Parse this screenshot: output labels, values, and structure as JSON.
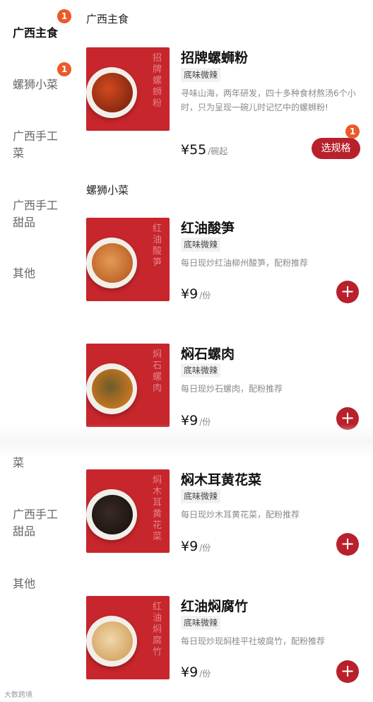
{
  "sidebar": {
    "categories": [
      {
        "label": "广西主食",
        "badge": "1",
        "active": true
      },
      {
        "label": "螺狮小菜",
        "badge": "1"
      },
      {
        "label": "广西手工菜"
      },
      {
        "label": "广西手工甜品"
      },
      {
        "label": "其他"
      },
      {
        "label": "菜"
      },
      {
        "label": "广西手工甜品"
      },
      {
        "label": "其他"
      }
    ]
  },
  "sections": [
    {
      "title": "广西主食"
    },
    {
      "title": "螺狮小菜"
    }
  ],
  "products": [
    {
      "name": "招牌螺蛳粉",
      "thumb_text": "招牌螺蛳粉",
      "tag": "底味微辣",
      "desc": "寻味山海，两年研发，四十多种食材熬汤6个小时，只为呈现一碗儿时记忆中的螺蛳粉!",
      "price": "¥55",
      "unit": "/碗起",
      "action_label": "选规格",
      "action_badge": "1"
    },
    {
      "name": "红油酸笋",
      "thumb_text": "红油酸笋",
      "tag": "底味微辣",
      "desc": "每日现炒红油柳州酸笋，配粉推荐",
      "price": "¥9",
      "unit": "/份",
      "action_label": "+"
    },
    {
      "name": "焖石螺肉",
      "thumb_text": "焖石螺肉",
      "tag": "底味微辣",
      "desc": "每日现炒石螺肉，配粉推荐",
      "price": "¥9",
      "unit": "/份",
      "action_label": "+"
    },
    {
      "name": "焖木耳黄花菜",
      "thumb_text": "焖木耳黄花菜",
      "tag": "底味微辣",
      "desc": "每日现炒木耳黄花菜，配粉推荐",
      "price": "¥9",
      "unit": "/份",
      "action_label": "+"
    },
    {
      "name": "红油焖腐竹",
      "thumb_text": "红油焖腐竹",
      "tag": "底味微辣",
      "desc": "每日现炒现焖桂平社坡腐竹，配粉推荐",
      "price": "¥9",
      "unit": "/份",
      "action_label": "+"
    }
  ],
  "watermark": "大数跨境",
  "colors": {
    "brand_red": "#b8202c",
    "badge_orange": "#ea5a2a",
    "thumb_red": "#c6262c"
  },
  "icons": {
    "add": "plus-icon",
    "sidebar_badge": "count-badge"
  }
}
